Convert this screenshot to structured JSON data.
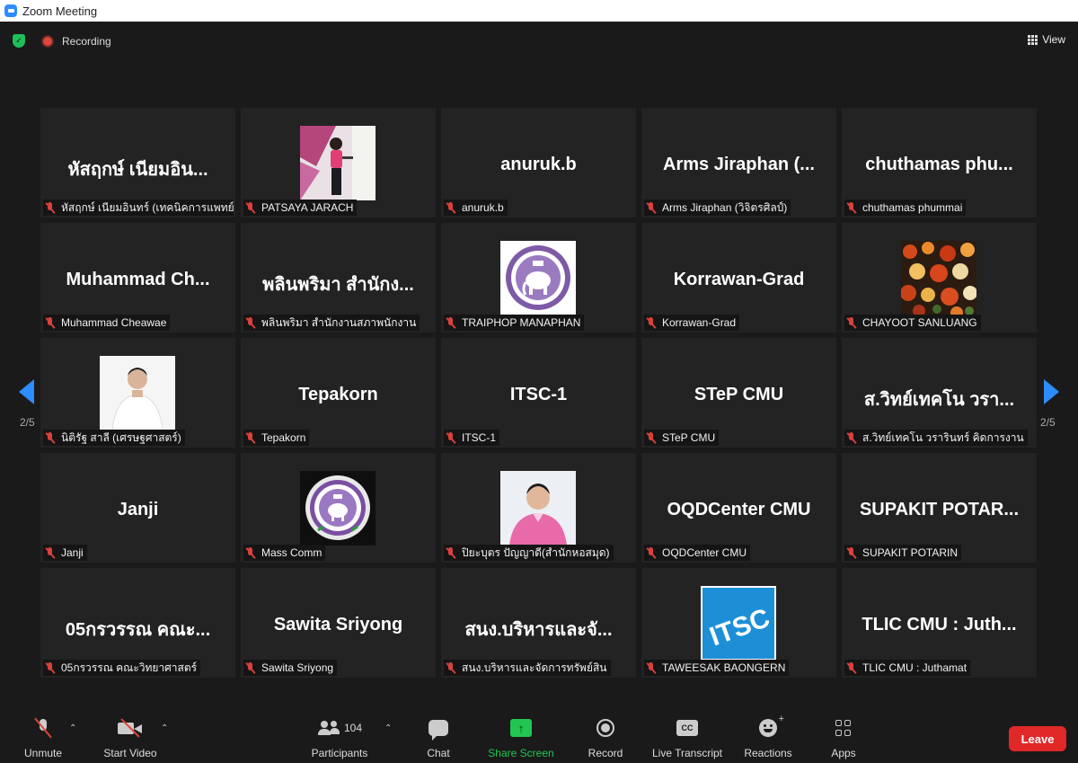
{
  "window": {
    "title": "Zoom Meeting"
  },
  "topbar": {
    "recording_label": "Recording",
    "view_label": "View"
  },
  "pagination": {
    "left": "2/5",
    "right": "2/5"
  },
  "tiles": [
    {
      "name": "หัสฤกษ์ เนียมอิน...",
      "label": "หัสฤกษ์ เนียมอินทร์ (เทคนิคการแพทย์)",
      "photo": null
    },
    {
      "name": "",
      "label": "PATSAYA JARACH",
      "photo": "presenter"
    },
    {
      "name": "anuruk.b",
      "label": "anuruk.b",
      "photo": null
    },
    {
      "name": "Arms Jiraphan (...",
      "label": "Arms Jiraphan (วิจิตรศิลป์)",
      "photo": null
    },
    {
      "name": "chuthamas phu...",
      "label": "chuthamas phummai",
      "photo": null
    },
    {
      "name": "Muhammad Ch...",
      "label": "Muhammad Cheawae",
      "photo": null
    },
    {
      "name": "พลินพริมา สำนักง...",
      "label": "พลินพริมา สำนักงานสภาพนักงาน",
      "photo": null
    },
    {
      "name": "",
      "label": "TRAIPHOP MANAPHAN",
      "photo": "seal-white"
    },
    {
      "name": "Korrawan-Grad",
      "label": "Korrawan-Grad",
      "photo": null
    },
    {
      "name": "",
      "label": "CHAYOOT SANLUANG",
      "photo": "flowers"
    },
    {
      "name": "",
      "label": "นิติรัฐ สาลี (เศรษฐศาสตร์)",
      "photo": "man-white-shirt"
    },
    {
      "name": "Tepakorn",
      "label": "Tepakorn",
      "photo": null
    },
    {
      "name": "ITSC-1",
      "label": "ITSC-1",
      "photo": null
    },
    {
      "name": "STeP CMU",
      "label": "STeP CMU",
      "photo": null
    },
    {
      "name": "ส.วิทย์เทคโน วรา...",
      "label": "ส.วิทย์เทคโน วรารินทร์ คิดการงาน",
      "photo": null
    },
    {
      "name": "Janji",
      "label": "Janji",
      "photo": null
    },
    {
      "name": "",
      "label": "Mass Comm",
      "photo": "seal-dark"
    },
    {
      "name": "",
      "label": "ปิยะบุตร ปัญญาดี(สำนักหอสมุด)",
      "photo": "man-pink-shirt"
    },
    {
      "name": "OQDCenter CMU",
      "label": "OQDCenter CMU",
      "photo": null
    },
    {
      "name": "SUPAKIT POTAR...",
      "label": "SUPAKIT POTARIN",
      "photo": null
    },
    {
      "name": "05กรวรรณ คณะ...",
      "label": "05กรวรรณ คณะวิทยาศาสตร์",
      "photo": null
    },
    {
      "name": "Sawita Sriyong",
      "label": "Sawita Sriyong",
      "photo": null
    },
    {
      "name": "สนง.บริหารและจั...",
      "label": "สนง.บริหารและจัดการทรัพย์สิน",
      "photo": null
    },
    {
      "name": "",
      "label": "TAWEESAK BAONGERN",
      "photo": "itsc-logo"
    },
    {
      "name": "TLIC CMU : Juth...",
      "label": "TLIC CMU : Juthamat",
      "photo": null
    }
  ],
  "toolbar": {
    "unmute": "Unmute",
    "start_video": "Start Video",
    "participants": "Participants",
    "participants_count": "104",
    "chat": "Chat",
    "share_screen": "Share Screen",
    "record": "Record",
    "live_transcript": "Live Transcript",
    "cc_glyph": "CC",
    "reactions": "Reactions",
    "apps": "Apps",
    "leave": "Leave"
  },
  "photo_texts": {
    "itsc_logo": "ITSC"
  },
  "colors": {
    "accent": "#2d8cff",
    "muted": "#d9413b",
    "share": "#23c552",
    "leave": "#e02828"
  }
}
